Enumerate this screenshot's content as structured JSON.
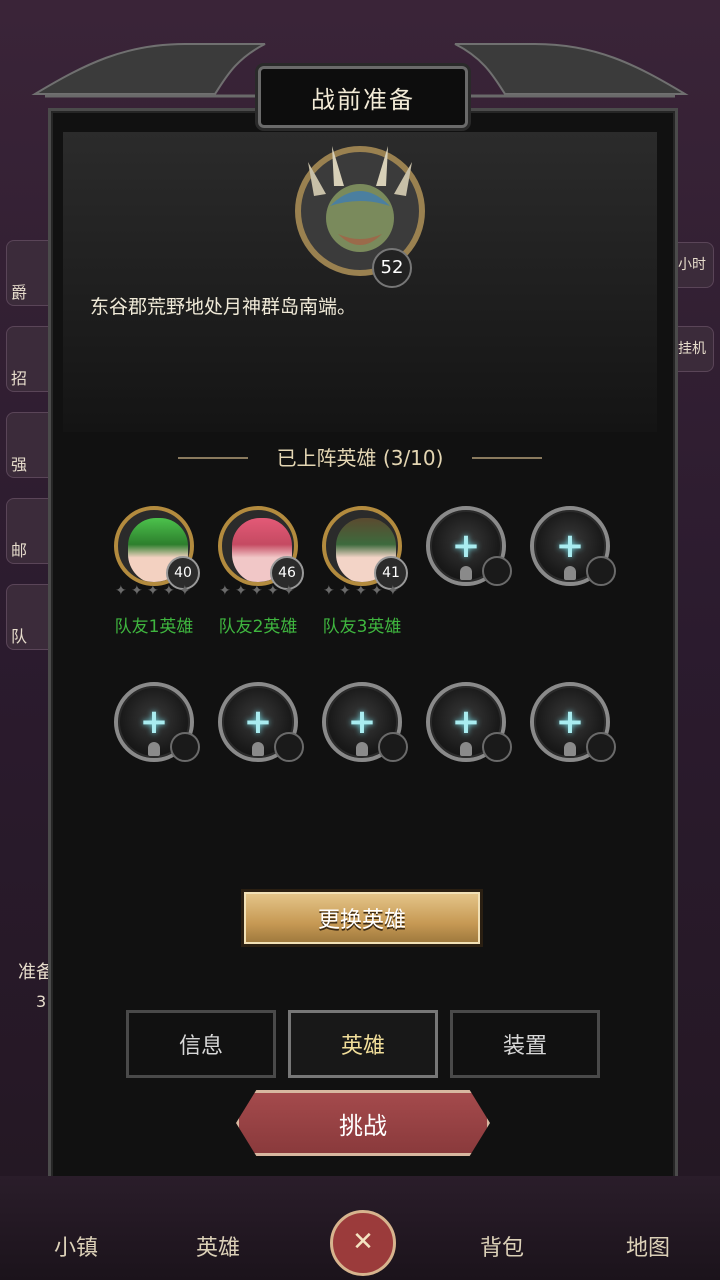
{
  "title": "战前准备",
  "boss": {
    "level": "52"
  },
  "description": "东谷郡荒野地处月神群岛南端。",
  "team_header": "已上阵英雄 (3/10)",
  "heroes": [
    {
      "name": "队友1英雄",
      "level": "40"
    },
    {
      "name": "队友2英雄",
      "level": "46"
    },
    {
      "name": "队友3英雄",
      "level": "41"
    }
  ],
  "slots": {
    "empty_icon": "+"
  },
  "buttons": {
    "change": "更换英雄",
    "challenge": "挑战"
  },
  "tabs": [
    "信息",
    "英雄",
    "装置"
  ],
  "nav": [
    "小镇",
    "英雄",
    "背包",
    "地图"
  ],
  "nav_center_icon": "swords-icon",
  "side_left": [
    "爵",
    "招",
    "强",
    "邮",
    "队"
  ],
  "side_right": [
    "小时",
    "挂机"
  ],
  "left_text": "准备",
  "left_num": "3",
  "colors": {
    "accent_gold": "#c79a55",
    "name_green": "#3fb63f",
    "challenge_red": "#a44a4c"
  }
}
